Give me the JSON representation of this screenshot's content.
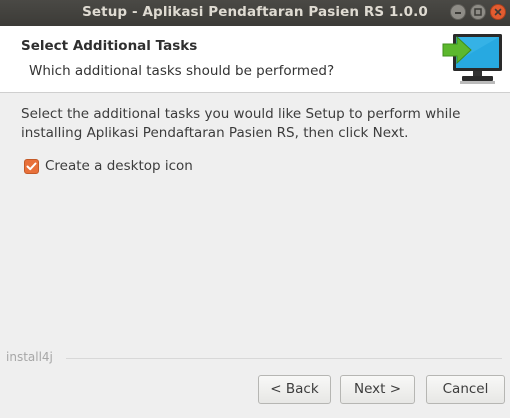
{
  "window": {
    "title": "Setup - Aplikasi Pendaftaran Pasien RS 1.0.0",
    "controls": [
      "minimize-icon",
      "maximize-icon",
      "close-icon"
    ]
  },
  "header": {
    "title": "Select Additional Tasks",
    "subtitle": "Which additional tasks should be performed?",
    "icon": "install-monitor-arrow-icon"
  },
  "content": {
    "description": "Select the additional tasks you would like Setup to perform while installing Aplikasi Pendaftaran Pasien RS, then click Next.",
    "tasks": [
      {
        "label": "Create a desktop icon",
        "checked": true
      }
    ]
  },
  "footer": {
    "brand": "install4j",
    "back_label": "< Back",
    "next_label": "Next >",
    "cancel_label": "Cancel"
  },
  "colors": {
    "titlebar": "#3c3b37",
    "close_button": "#e35c30",
    "checkbox": "#e8703a",
    "arrow": "#5cb82d",
    "screen": "#27a9e1"
  }
}
